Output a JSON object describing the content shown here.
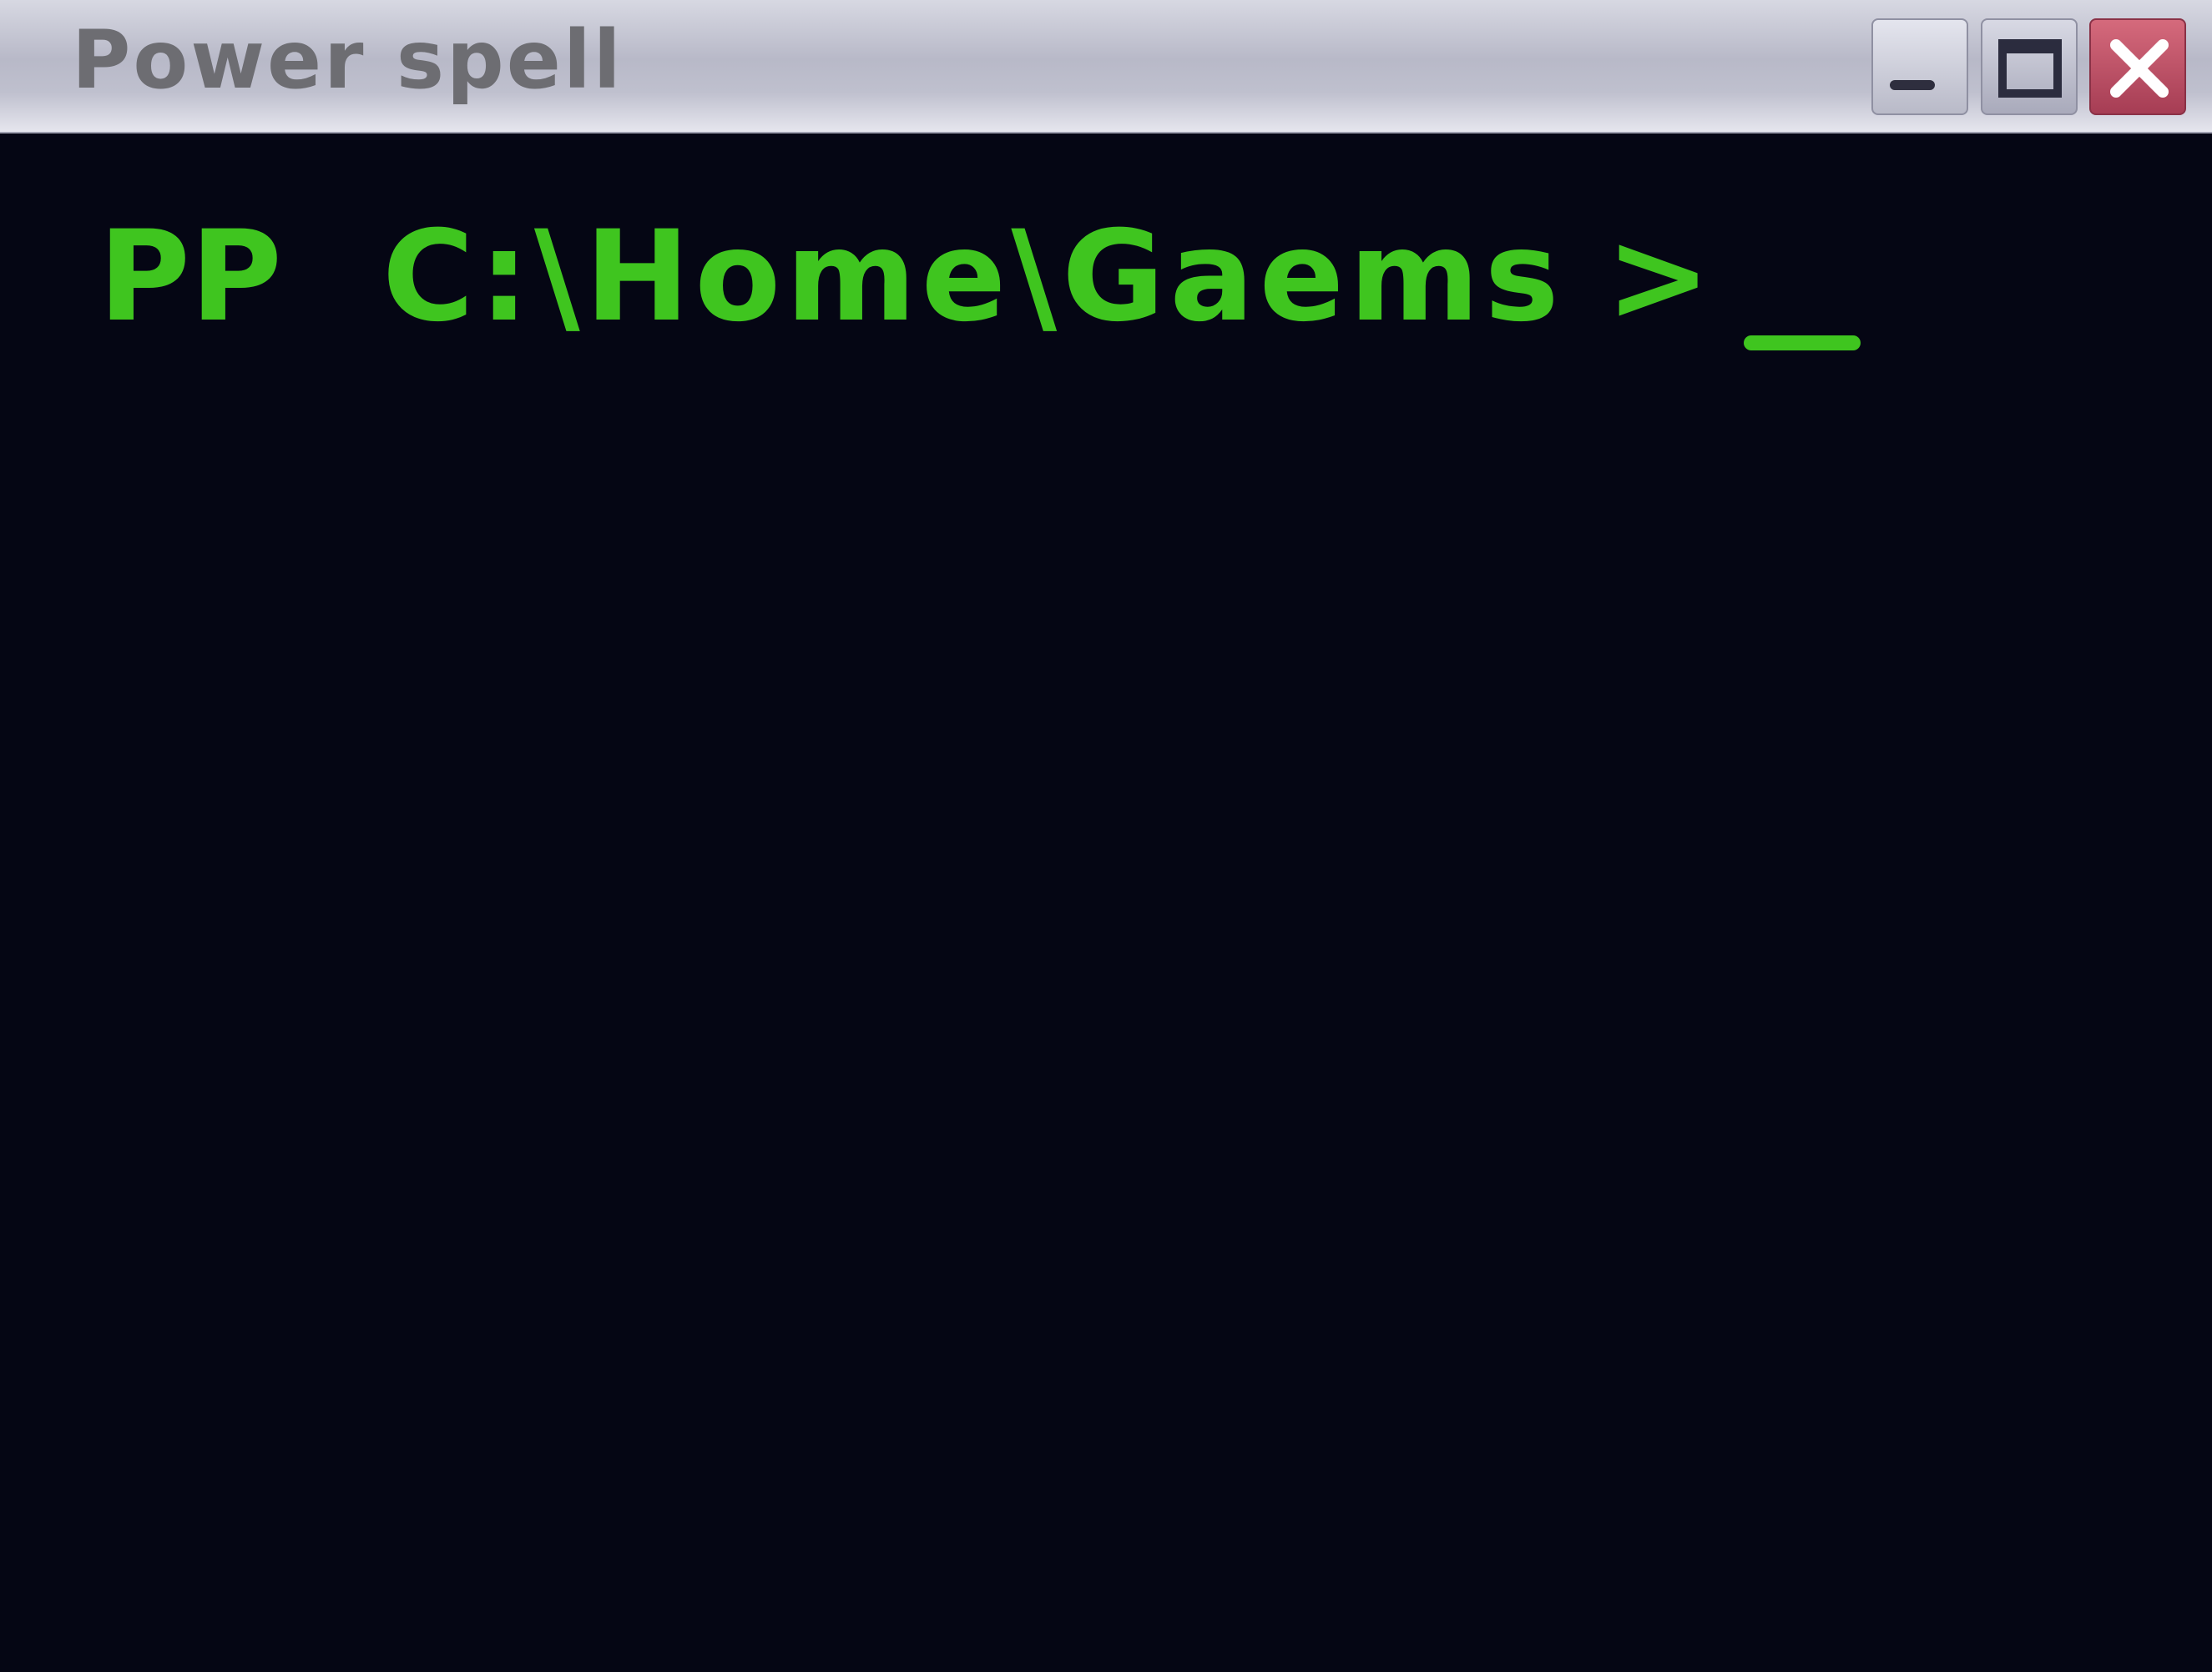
{
  "window": {
    "title": "Power spell",
    "controls": {
      "minimize_icon": "minimize-icon",
      "maximize_icon": "maximize-icon",
      "close_icon": "close-icon"
    }
  },
  "terminal": {
    "prompt_prefix": "PP",
    "path": "C:\\Home\\Gaems",
    "prompt_symbol": ">",
    "text_color": "#3fc51f",
    "background_color": "#050614"
  }
}
